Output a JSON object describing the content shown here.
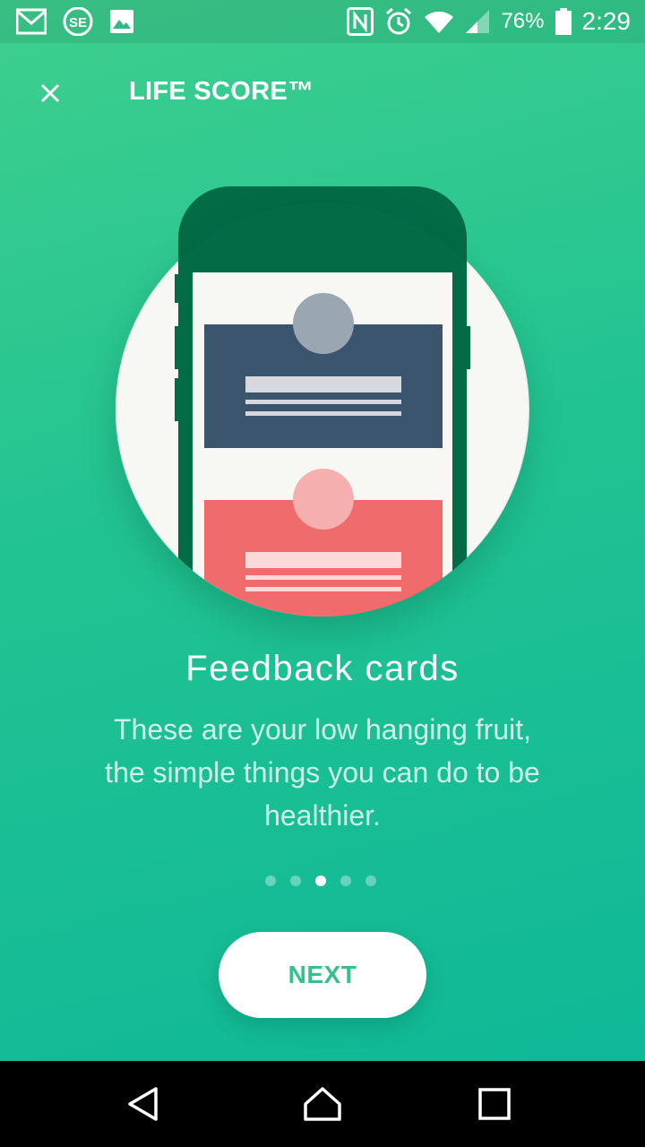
{
  "status_bar": {
    "left_icons": [
      "gmail-icon",
      "news-app-icon",
      "gallery-icon"
    ],
    "right_icons": [
      "nfc-icon",
      "alarm-icon",
      "wifi-icon",
      "signal-icon",
      "battery-icon"
    ],
    "battery_percent": "76%",
    "time": "2:29"
  },
  "app_bar": {
    "close_icon": "close-icon",
    "title": "LIFE SCORE™"
  },
  "onboarding": {
    "headline": "Feedback cards",
    "body": "These are your low hanging fruit, the simple things you can do to be healthier.",
    "page_count": 5,
    "current_page_index": 2,
    "next_label": "NEXT"
  },
  "colors": {
    "gradient_top": "#3ecf8e",
    "gradient_bottom": "#0fb897",
    "phone_dark_green": "#046b47",
    "card_navy": "#3b556f",
    "card_coral": "#f06b6b",
    "accent_text": "#34c28a"
  },
  "nav_bar": {
    "icons": [
      "back-icon",
      "home-icon",
      "recents-icon"
    ]
  }
}
